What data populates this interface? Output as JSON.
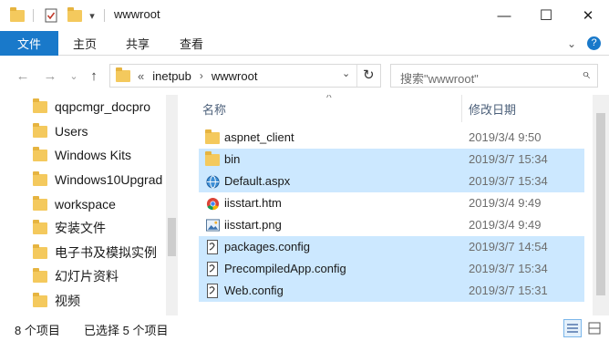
{
  "window": {
    "title": "wwwroot",
    "minimize_glyph": "—",
    "maximize_glyph": "☐",
    "close_glyph": "✕"
  },
  "ribbon": {
    "tabs": [
      "文件",
      "主页",
      "共享",
      "查看"
    ],
    "collapse_glyph": "⌄",
    "help_glyph": "?"
  },
  "address": {
    "back_glyph": "←",
    "forward_glyph": "→",
    "recent_glyph": "⌄",
    "up_glyph": "↑",
    "overflow": "«",
    "crumbs": [
      "inetpub",
      "wwwroot"
    ],
    "crumb_sep": "›",
    "dropdown_glyph": "⌄",
    "refresh_glyph": "↻"
  },
  "search": {
    "placeholder": "搜索\"wwwroot\"",
    "icon_glyph": "⌕"
  },
  "nav": {
    "items": [
      "qqpcmgr_docpro",
      "Users",
      "Windows Kits",
      "Windows10Upgrad",
      "workspace",
      "安装文件",
      "电子书及模拟实例",
      "幻灯片资料",
      "视频"
    ]
  },
  "list": {
    "header_name": "名称",
    "header_date": "修改日期",
    "sort_glyph": "^",
    "files": [
      {
        "name": "aspnet_client",
        "date": "2019/3/4 9:50",
        "icon": "folder-icon",
        "selected": false
      },
      {
        "name": "bin",
        "date": "2019/3/7 15:34",
        "icon": "folder-icon",
        "selected": true
      },
      {
        "name": "Default.aspx",
        "date": "2019/3/7 15:34",
        "icon": "globe-icon",
        "selected": true
      },
      {
        "name": "iisstart.htm",
        "date": "2019/3/4 9:49",
        "icon": "chrome-icon",
        "selected": false
      },
      {
        "name": "iisstart.png",
        "date": "2019/3/4 9:49",
        "icon": "image-icon",
        "selected": false
      },
      {
        "name": "packages.config",
        "date": "2019/3/7 14:54",
        "icon": "config-icon",
        "selected": true
      },
      {
        "name": "PrecompiledApp.config",
        "date": "2019/3/7 15:34",
        "icon": "config-icon",
        "selected": true
      },
      {
        "name": "Web.config",
        "date": "2019/3/7 15:31",
        "icon": "config-icon",
        "selected": true
      }
    ]
  },
  "status": {
    "item_count": "8 个项目",
    "selected_count": "已选择 5 个项目"
  },
  "colors": {
    "accent": "#1979ca",
    "selection": "#cce8ff",
    "folder": "#f4c95d"
  }
}
